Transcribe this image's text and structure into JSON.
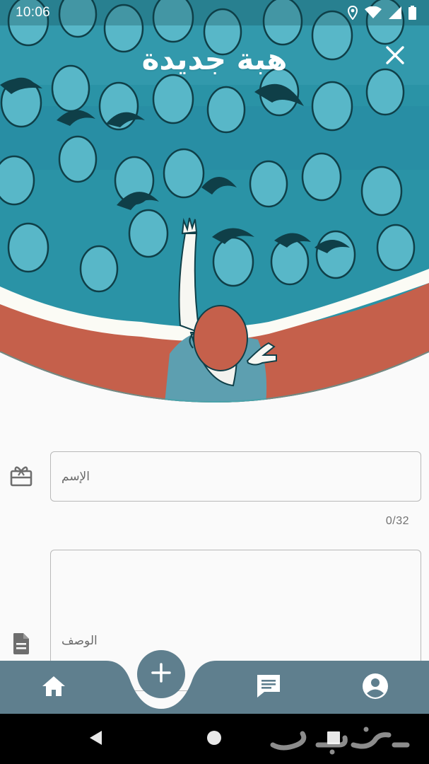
{
  "status_bar": {
    "time": "10:06",
    "icons": [
      "location-icon",
      "wifi-icon",
      "signal-icon",
      "battery-icon"
    ]
  },
  "header": {
    "title": "هبة جديدة",
    "close_icon": "close-icon"
  },
  "form": {
    "name_placeholder": "الإسم",
    "name_value": "",
    "name_counter": "0/32",
    "description_placeholder": "الوصف",
    "description_value": "",
    "name_icon": "gift-card-icon",
    "description_icon": "document-icon"
  },
  "bottom_nav": {
    "items": [
      {
        "icon": "home-icon"
      },
      {
        "icon": "add-icon"
      },
      {
        "icon": "chat-icon"
      },
      {
        "icon": "account-icon"
      }
    ]
  },
  "system_nav": {
    "items": [
      {
        "icon": "back-icon"
      },
      {
        "icon": "home-circle-icon"
      },
      {
        "icon": "recents-icon"
      }
    ],
    "watermark": "حراج"
  },
  "colors": {
    "hero_teal": "#2a93a6",
    "hero_dark": "#0f3f48",
    "wave_red": "#c5604b",
    "nav_bar": "#5f7f8e",
    "background": "#fafafa",
    "outline": "#b8b8b8"
  }
}
